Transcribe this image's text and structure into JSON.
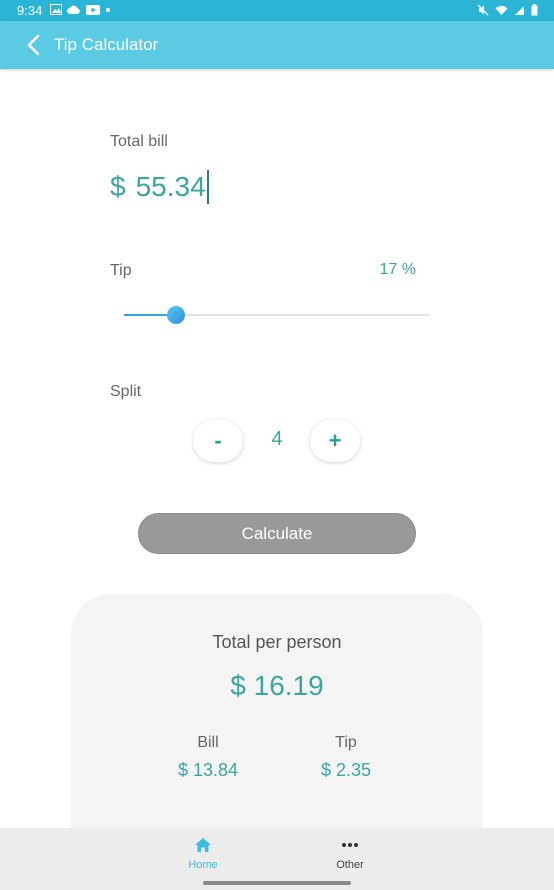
{
  "status_bar": {
    "time": "9:34",
    "left_icons": [
      "image-icon",
      "cloud-icon",
      "youtube-icon",
      "dot-icon"
    ],
    "right_icons": [
      "mute-icon",
      "wifi-icon",
      "signal-icon",
      "battery-icon"
    ]
  },
  "app_bar": {
    "title": "Tip Calculator",
    "back_icon": "chevron-left-icon"
  },
  "bill": {
    "label": "Total bill",
    "currency": "$",
    "value": "55.34"
  },
  "tip": {
    "label": "Tip",
    "value_text": "17 %",
    "slider_fraction": 0.17
  },
  "split": {
    "label": "Split",
    "minus_label": "-",
    "value": "4",
    "plus_label": "+"
  },
  "calculate_label": "Calculate",
  "result": {
    "title": "Total per person",
    "total": "$ 16.19",
    "bill_label": "Bill",
    "bill_value": "$ 13.84",
    "tip_label": "Tip",
    "tip_value": "$ 2.35"
  },
  "nav": [
    {
      "label": "Home",
      "icon": "home-icon",
      "active": true
    },
    {
      "label": "Other",
      "icon": "more-icon",
      "active": false
    }
  ],
  "colors": {
    "accent": "#3aa6a0",
    "app_bar": "#5bcbe4",
    "status_bar": "#2ab4d6",
    "active_nav": "#3bbde0"
  }
}
